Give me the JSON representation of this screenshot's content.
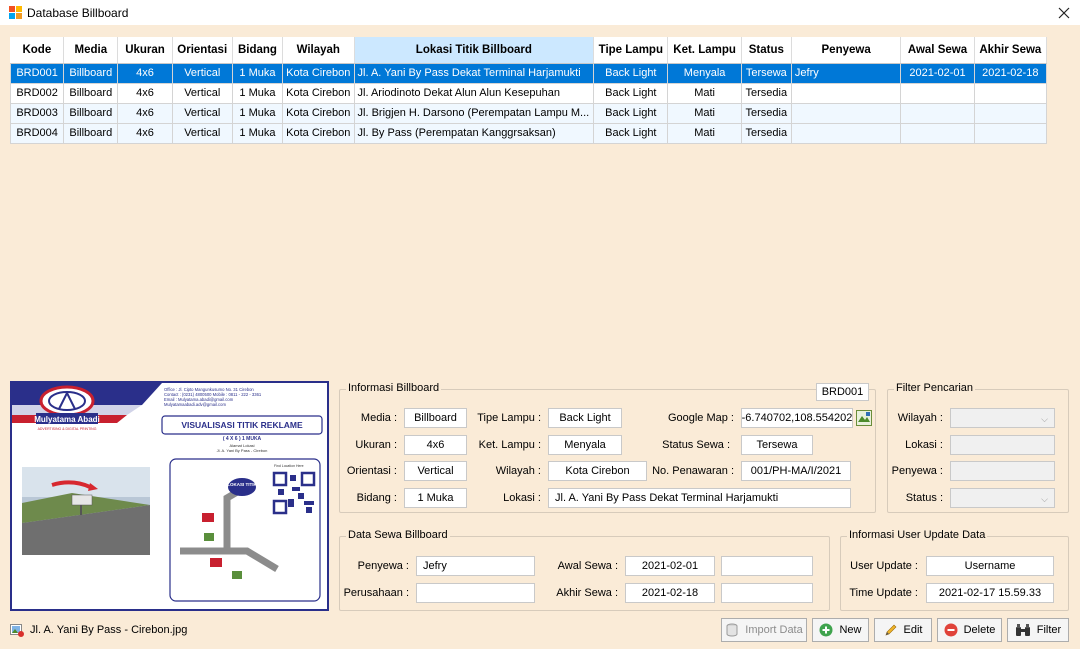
{
  "window": {
    "title": "Database Billboard"
  },
  "grid": {
    "columns": [
      "Kode",
      "Media",
      "Ukuran",
      "Orientasi",
      "Bidang",
      "Wilayah",
      "Lokasi Titik Billboard",
      "Tipe Lampu",
      "Ket. Lampu",
      "Status",
      "Penyewa",
      "Awal Sewa",
      "Akhir Sewa"
    ],
    "rows": [
      [
        "BRD001",
        "Billboard",
        "4x6",
        "Vertical",
        "1 Muka",
        "Kota Cirebon",
        "Jl. A. Yani By Pass Dekat Terminal Harjamukti",
        "Back Light",
        "Menyala",
        "Tersewa",
        "Jefry",
        "2021-02-01",
        "2021-02-18"
      ],
      [
        "BRD002",
        "Billboard",
        "4x6",
        "Vertical",
        "1 Muka",
        "Kota Cirebon",
        "Jl. Ariodinoto Dekat Alun Alun Kesepuhan",
        "Back Light",
        "Mati",
        "Tersedia",
        "",
        "",
        ""
      ],
      [
        "BRD003",
        "Billboard",
        "4x6",
        "Vertical",
        "1 Muka",
        "Kota Cirebon",
        "Jl. Brigjen H. Darsono (Perempatan Lampu M...",
        "Back Light",
        "Mati",
        "Tersedia",
        "",
        "",
        ""
      ],
      [
        "BRD004",
        "Billboard",
        "4x6",
        "Vertical",
        "1 Muka",
        "Kota Cirebon",
        "Jl. By Pass (Perempatan Kanggrsaksan)",
        "Back Light",
        "Mati",
        "Tersedia",
        "",
        "",
        ""
      ]
    ]
  },
  "picture": {
    "company": "Mulyatama Abadi",
    "company_sub": "ADVERTISING & DIGITAL PRINTING",
    "contact_lines": [
      "Office   : Jl. Cipto Mangunkusumo No. 31 Cirebon",
      "Contact : (0231) 4800500   Mobile : 0811 - 222 - 3361",
      "Email   : Mulyatama.abadi@gmail.com",
      "             Mulyatamaabadi.adv@gmail.com"
    ],
    "heading": "VISUALISASI TITIK REKLAME",
    "size_line": "( 4 X 6 ) 1 MUKA",
    "address_caption": "Alamat Lokasi",
    "address": "Jl. A. Yani By Pass - Cirebon",
    "lokasi_tag": "LOKASI TITIK",
    "qr_caption": "Find Location Here",
    "filename": "Jl. A. Yani By Pass - Cirebon.jpg"
  },
  "info": {
    "title": "Informasi Billboard",
    "code": "BRD001",
    "media_label": "Media :",
    "media": "Billboard",
    "ukuran_label": "Ukuran :",
    "ukuran": "4x6",
    "orientasi_label": "Orientasi :",
    "orientasi": "Vertical",
    "bidang_label": "Bidang :",
    "bidang": "1 Muka",
    "tipe_lampu_label": "Tipe Lampu :",
    "tipe_lampu": "Back Light",
    "ket_lampu_label": "Ket. Lampu :",
    "ket_lampu": "Menyala",
    "wilayah_label": "Wilayah :",
    "wilayah": "Kota Cirebon",
    "lokasi_label": "Lokasi :",
    "lokasi": "Jl. A. Yani By Pass Dekat Terminal Harjamukti",
    "gmap_label": "Google Map :",
    "gmap": "-6.740702,108.554202",
    "status_sewa_label": "Status Sewa :",
    "status_sewa": "Tersewa",
    "penawaran_label": "No. Penawaran :",
    "penawaran": "001/PH-MA/I/2021"
  },
  "filter": {
    "title": "Filter Pencarian",
    "wilayah_label": "Wilayah :",
    "lokasi_label": "Lokasi :",
    "penyewa_label": "Penyewa :",
    "status_label": "Status :"
  },
  "sewa": {
    "title": "Data Sewa Billboard",
    "penyewa_label": "Penyewa :",
    "penyewa": "Jefry",
    "perusahaan_label": "Perusahaan :",
    "perusahaan": "",
    "awal_label": "Awal Sewa :",
    "awal": "2021-02-01",
    "akhir_label": "Akhir Sewa :",
    "akhir": "2021-02-18"
  },
  "user_update": {
    "title": "Informasi User Update Data",
    "user_label": "User Update :",
    "user": "Username",
    "time_label": "Time Update :",
    "time": "2021-02-17 15.59.33"
  },
  "buttons": {
    "import": "Import Data",
    "new": "New",
    "edit": "Edit",
    "delete": "Delete",
    "filter": "Filter"
  },
  "colors": {
    "selection": "#0078d7",
    "background": "#faebd7",
    "header_selected": "#cce8ff",
    "picture_border": "#2a2f8a"
  }
}
